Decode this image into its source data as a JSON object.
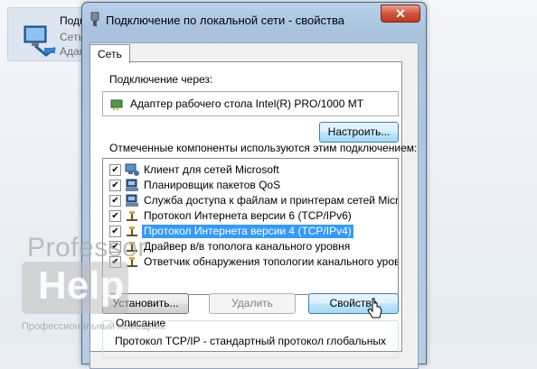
{
  "background": {
    "item_title": "Подкл",
    "item_line2": "Сеть",
    "item_line3": "Адап"
  },
  "dialog": {
    "title": "Подключение по локальной сети - свойства",
    "close_glyph": "✕",
    "tab_label": "Сеть",
    "connect_via_label": "Подключение через:",
    "adapter_name": "Адаптер рабочего стола Intel(R) PRO/1000 MT",
    "configure_button": "Настроить...",
    "components_label": "Отмеченные компоненты используются этим подключением:",
    "components": [
      {
        "label": "Клиент для сетей Microsoft",
        "checked": true,
        "icon": "network-client-icon",
        "selected": false
      },
      {
        "label": "Планировщик пакетов QoS",
        "checked": true,
        "icon": "service-icon",
        "selected": false
      },
      {
        "label": "Служба доступа к файлам и принтерам сетей Micro...",
        "checked": true,
        "icon": "service-icon",
        "selected": false
      },
      {
        "label": "Протокол Интернета версии 6 (TCP/IPv6)",
        "checked": true,
        "icon": "protocol-icon",
        "selected": false
      },
      {
        "label": "Протокол Интернета версии 4 (TCP/IPv4)",
        "checked": true,
        "icon": "protocol-icon",
        "selected": true
      },
      {
        "label": "Драйвер в/в тополога канального уровня",
        "checked": true,
        "icon": "protocol-icon",
        "selected": false
      },
      {
        "label": "Ответчик обнаружения топологии канального уровня",
        "checked": true,
        "icon": "protocol-icon",
        "selected": false
      }
    ],
    "install_button": "Установить...",
    "remove_button": "Удалить",
    "properties_button": "Свойства",
    "description_title": "Описание",
    "description_text": "Протокол TCP/IP - стандартный протокол глобальных"
  },
  "watermark": {
    "line1": "Professor",
    "logo_text": "Help",
    "tagline": "Профессиональный помощник"
  },
  "colors": {
    "selection": "#3399ff",
    "title_bar": "#b9d1ea",
    "close_button": "#c0381c"
  }
}
